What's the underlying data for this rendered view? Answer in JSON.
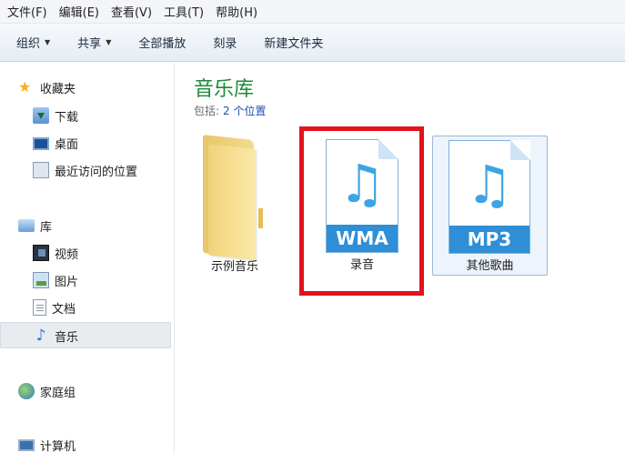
{
  "menu": [
    "文件(F)",
    "编辑(E)",
    "查看(V)",
    "工具(T)",
    "帮助(H)"
  ],
  "toolbar": {
    "organize": "组织",
    "share": "共享",
    "play_all": "全部播放",
    "burn": "刻录",
    "new_folder": "新建文件夹"
  },
  "nav": {
    "favorites": "收藏夹",
    "downloads": "下载",
    "desktop": "桌面",
    "recent": "最近访问的位置",
    "libraries": "库",
    "videos": "视频",
    "pictures": "图片",
    "documents": "文档",
    "music": "音乐",
    "homegroup": "家庭组",
    "computer": "计算机"
  },
  "content": {
    "title": "音乐库",
    "include_label": "包括:",
    "include_link": "2 个位置"
  },
  "items": [
    {
      "label": "示例音乐",
      "badge": ""
    },
    {
      "label": "录音",
      "badge": "WMA"
    },
    {
      "label": "其他歌曲",
      "badge": "MP3"
    }
  ],
  "colors": {
    "highlight": "#e2131b",
    "accent_green": "#1e8a3a",
    "file_band": "#2e8fd6"
  }
}
